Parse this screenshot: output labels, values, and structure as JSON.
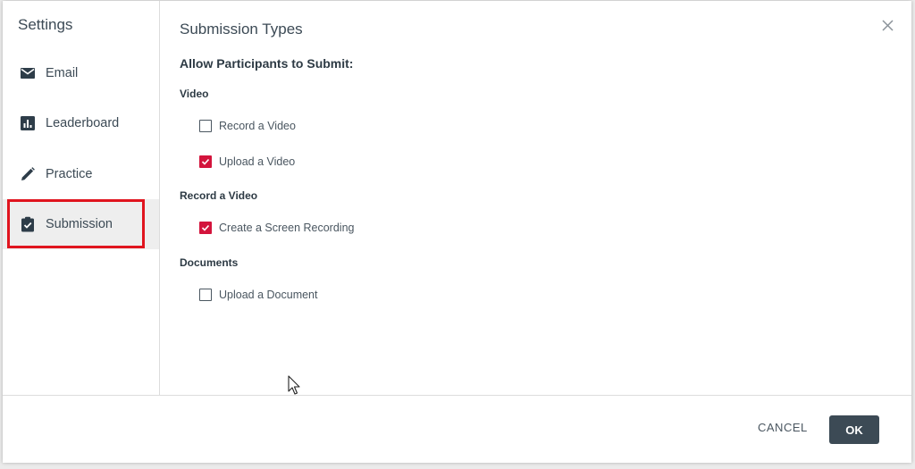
{
  "sidebar": {
    "title": "Settings",
    "items": [
      {
        "label": "Email",
        "icon": "envelope-icon"
      },
      {
        "label": "Leaderboard",
        "icon": "bar-chart-icon"
      },
      {
        "label": "Practice",
        "icon": "pencil-icon"
      },
      {
        "label": "Submission",
        "icon": "clipboard-check-icon",
        "active": true
      }
    ]
  },
  "main": {
    "title": "Submission Types",
    "subheading": "Allow Participants to Submit:",
    "groups": [
      {
        "label": "Video",
        "options": [
          {
            "label": "Record a Video",
            "checked": false
          },
          {
            "label": "Upload a Video",
            "checked": true
          }
        ]
      },
      {
        "label": "Record a Video",
        "options": [
          {
            "label": "Create a Screen Recording",
            "checked": true
          }
        ]
      },
      {
        "label": "Documents",
        "options": [
          {
            "label": "Upload a Document",
            "checked": false
          }
        ]
      }
    ]
  },
  "footer": {
    "cancel_label": "CANCEL",
    "ok_label": "OK"
  },
  "colors": {
    "accent": "#d3143c",
    "primary_button": "#3c4a55",
    "highlight": "#e0141e"
  }
}
